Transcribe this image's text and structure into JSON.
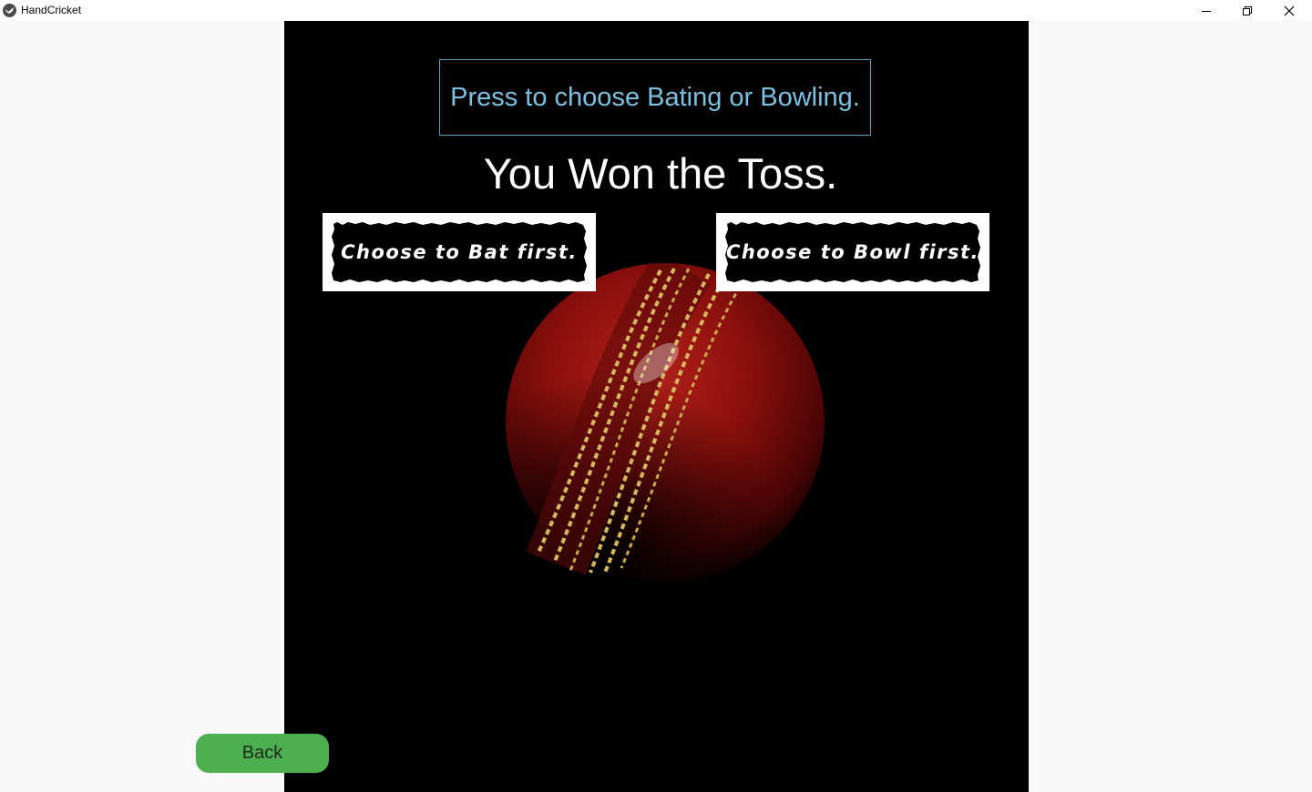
{
  "window": {
    "title": "HandCricket",
    "controls": [
      "minimize",
      "restore",
      "close"
    ]
  },
  "toss": {
    "prompt_label": "Press to choose Bating or Bowling.",
    "result_text": "You Won the Toss.",
    "bat_label": "Choose to Bat first.",
    "bowl_label": "Choose to Bowl first."
  },
  "footer": {
    "back_label": "Back"
  },
  "colors": {
    "stage_background": "#000000",
    "prompt_text": "#7cc0e0",
    "back_button": "#4caf50",
    "ball": "#8b0a0a",
    "seam": "#d6b860"
  },
  "icons": {
    "app": "app-logo-icon",
    "minimize": "minimize-icon",
    "restore": "restore-icon",
    "close": "close-icon"
  }
}
